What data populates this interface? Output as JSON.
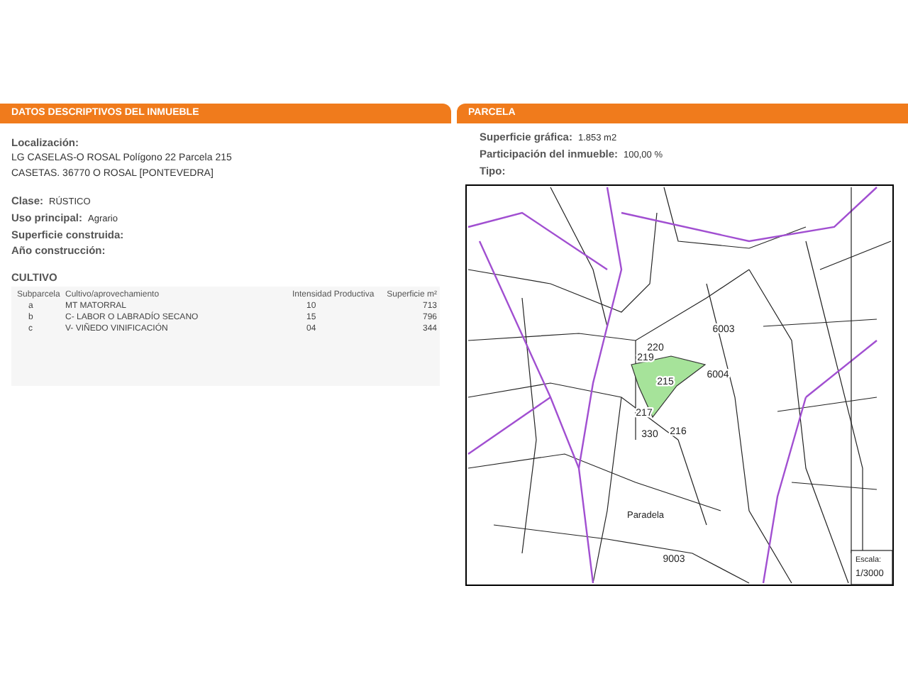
{
  "left_panel": {
    "title": "DATOS DESCRIPTIVOS DEL INMUEBLE",
    "location": {
      "label": "Localización:",
      "lines": [
        "LG CASELAS-O ROSAL  Polígono 22 Parcela 215",
        "CASETAS. 36770 O ROSAL [PONTEVEDRA]"
      ]
    },
    "fields": [
      {
        "label": "Clase:",
        "value": "RÚSTICO"
      },
      {
        "label": "Uso principal:",
        "value": "Agrario"
      },
      {
        "label": "Superficie construida:"
      },
      {
        "label": "Año construcción:"
      }
    ],
    "cultivo": {
      "title": "CULTIVO",
      "columns": [
        "Subparcela",
        "Cultivo/aprovechamiento",
        "Intensidad Productiva",
        "Superficie m²"
      ],
      "rows": [
        [
          "a",
          "MT MATORRAL",
          "10",
          "713"
        ],
        [
          "b",
          "C- LABOR O LABRADÍO  SECANO",
          "15",
          "796"
        ],
        [
          "c",
          "V- VIÑEDO VINIFICACIÓN",
          "04",
          "344"
        ]
      ]
    }
  },
  "right_panel": {
    "title": "PARCELA",
    "fields": [
      {
        "label": "Superficie gráfica:",
        "value": "1.853 m2"
      },
      {
        "label": "Participación del inmueble:",
        "value": "100,00 %"
      },
      {
        "label": "Tipo:"
      }
    ],
    "map": {
      "plot_labels": [
        "6003",
        "220",
        "219",
        "215",
        "6004",
        "217",
        "330",
        "216",
        "9003"
      ],
      "place_label": "Paradela",
      "scale_label": "Escala:",
      "scale_value": "1/3000"
    }
  }
}
